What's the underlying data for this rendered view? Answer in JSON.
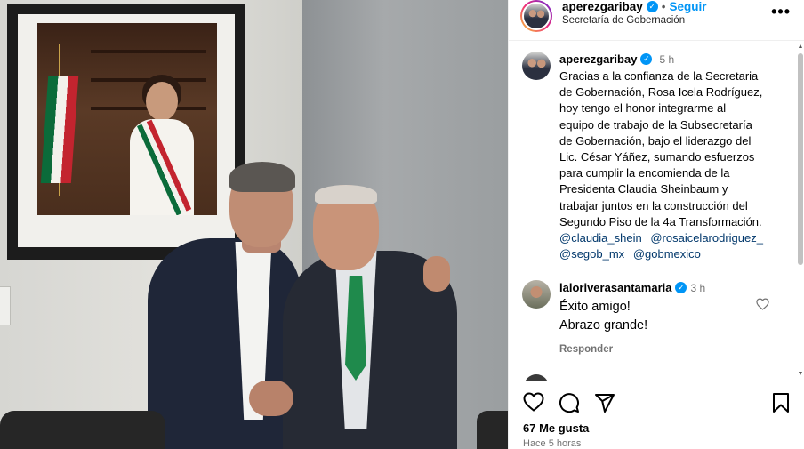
{
  "post": {
    "username": "aperezgaribay",
    "dot": "•",
    "follow_label": "Seguir",
    "location": "Secretaría de Gobernación",
    "more_label": "•••"
  },
  "caption": {
    "username": "aperezgaribay",
    "time": "5 h",
    "text": "Gracias a la confianza de la Secretaria\nde Gobernación, Rosa Icela Rodríguez,\nhoy tengo el honor integrarme al\nequipo de trabajo de la Subsecretaría\nde Gobernación, bajo el liderazgo del\nLic. César Yáñez,  sumando esfuerzos\npara cumplir la encomienda  de la\nPresidenta Claudia Sheinbaum y\ntrabajar juntos en la construcción del\nSegundo Piso de la 4a Transformación.",
    "mentions": [
      "@claudia_shein",
      "@rosaicelarodriguez_",
      "@segob_mx",
      "@gobmexico"
    ]
  },
  "comments": [
    {
      "username": "laloriverasantamaria",
      "time": "3 h",
      "lines": [
        "Éxito amigo!",
        "Abrazo grande!"
      ],
      "reply_label": "Responder"
    }
  ],
  "footer": {
    "likes": "67 Me gusta",
    "time_ago": "Hace 5 horas"
  },
  "icons": {
    "verified": "verified-badge-icon",
    "like": "heart-icon",
    "comment": "comment-icon",
    "share": "paper-plane-icon",
    "save": "bookmark-icon",
    "more": "more-options-icon"
  },
  "colors": {
    "link": "#0095f6",
    "mention": "#00376b",
    "muted": "#737373",
    "verified": "#0095f6"
  }
}
